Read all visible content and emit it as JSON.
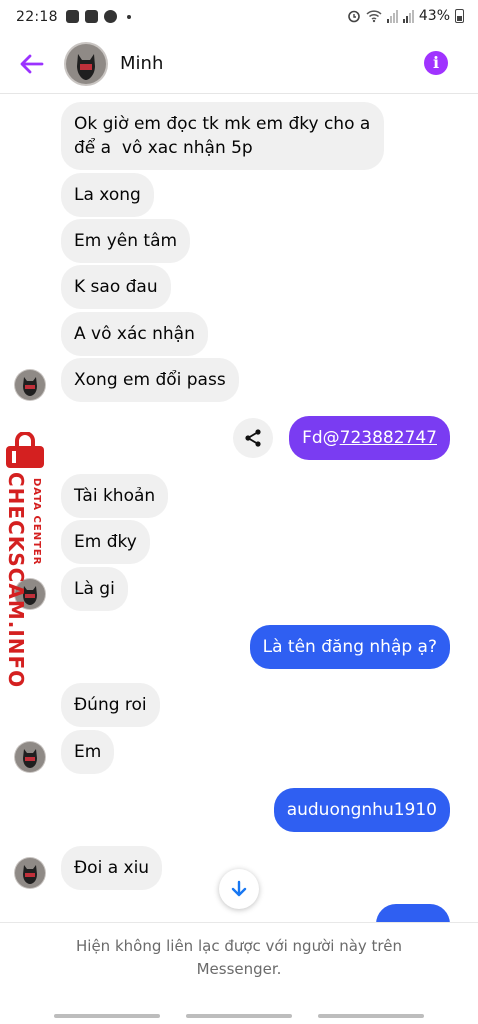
{
  "status_bar": {
    "time": "22:18",
    "battery": "43%"
  },
  "header": {
    "contact_name": "Minh",
    "back_icon": "arrow-left-icon",
    "info_icon": "info-icon",
    "accent_color": "#9b32ff"
  },
  "messages": [
    {
      "dir": "in",
      "text": "Ok giờ em đọc tk mk em đky cho a\nđể a  vô xac nhận 5p"
    },
    {
      "dir": "in",
      "text": "La xong"
    },
    {
      "dir": "in",
      "text": "Em yên tâm"
    },
    {
      "dir": "in",
      "text": "K sao đau"
    },
    {
      "dir": "in",
      "text": "A vô xác nhận"
    },
    {
      "dir": "in",
      "text": "Xong em đổi pass"
    },
    {
      "dir": "out",
      "text_prefix": "Fd@",
      "text_link": "723882747"
    },
    {
      "dir": "in",
      "text": "Tài khoản"
    },
    {
      "dir": "in",
      "text": "Em đky"
    },
    {
      "dir": "in",
      "text": "Là gi"
    },
    {
      "dir": "out",
      "text": "Là tên đăng nhập ạ?"
    },
    {
      "dir": "in",
      "text": "Đúng roi"
    },
    {
      "dir": "in",
      "text": "Em"
    },
    {
      "dir": "out",
      "text": "auduongnhu1910"
    },
    {
      "dir": "in",
      "text": "Đoi a xiu"
    }
  ],
  "watermark": {
    "title": "CHECKSCAM.INFO",
    "subtitle": "DATA CENTER",
    "color": "#d42020"
  },
  "footer": {
    "note": "Hiện không liên lạc được với người này trên Messenger."
  },
  "colors": {
    "bubble_in": "#f0f0f0",
    "bubble_out_purple": "#7a3cf2",
    "bubble_out_blue": "#2f5ff2"
  }
}
